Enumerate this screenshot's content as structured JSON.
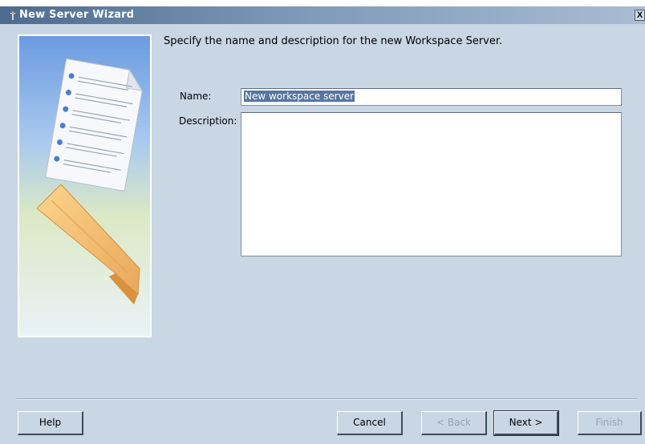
{
  "window": {
    "title": "New Server Wizard",
    "close_label": "X"
  },
  "main": {
    "instruction": "Specify the name and description for the new Workspace Server.",
    "name_label": "Name:",
    "name_value": "New workspace server",
    "description_label": "Description:",
    "description_value": ""
  },
  "buttons": {
    "help": "Help",
    "cancel": "Cancel",
    "back": "< Back",
    "next": "Next >",
    "finish": "Finish"
  },
  "colors": {
    "dialog_bg": "#c9d6e4",
    "titlebar_start": "#4d6a8f",
    "selection": "#5775a0"
  }
}
